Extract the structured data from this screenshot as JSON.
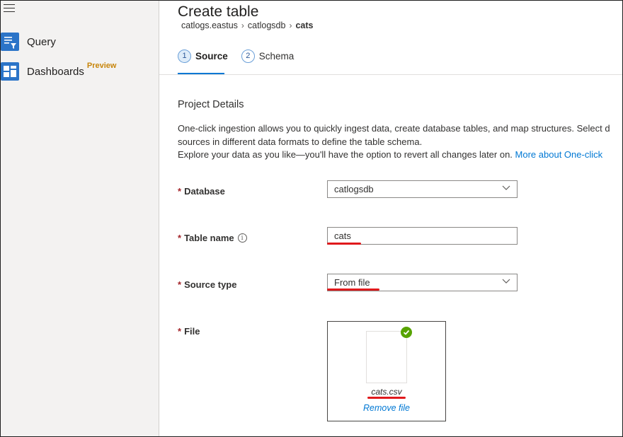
{
  "sidebar": {
    "menu_icon": "hamburger-icon",
    "items": [
      {
        "label": "Query",
        "icon": "query-icon"
      },
      {
        "label": "Dashboards",
        "icon": "dashboards-icon",
        "badge": "Preview"
      }
    ]
  },
  "header": {
    "title": "Create table",
    "breadcrumb": [
      "catlogs.eastus",
      "catlogsdb",
      "cats"
    ]
  },
  "tabs": [
    {
      "number": "1",
      "label": "Source",
      "active": true
    },
    {
      "number": "2",
      "label": "Schema",
      "active": false
    }
  ],
  "project": {
    "section_title": "Project Details",
    "desc_line1": "One-click ingestion allows you to quickly ingest data, create database tables, and map structures. Select d",
    "desc_line2": "sources in different data formats to define the table schema.",
    "desc_line3": "Explore your data as you like—you'll have the option to revert all changes later on.",
    "more_link": "More about One-click"
  },
  "form": {
    "required_mark": "*",
    "database": {
      "label": "Database",
      "value": "catlogsdb"
    },
    "table_name": {
      "label": "Table name",
      "value": "cats",
      "info_icon": "info-icon"
    },
    "source_type": {
      "label": "Source type",
      "value": "From file"
    },
    "file": {
      "label": "File",
      "file_name": "cats.csv",
      "remove_label": "Remove file",
      "status_icon": "check-circle-icon"
    }
  },
  "colors": {
    "accent": "#0078d4",
    "required": "#a4262c",
    "preview_badge": "#c7850a",
    "success": "#57a300",
    "annotation_underline": "#e0191c"
  }
}
